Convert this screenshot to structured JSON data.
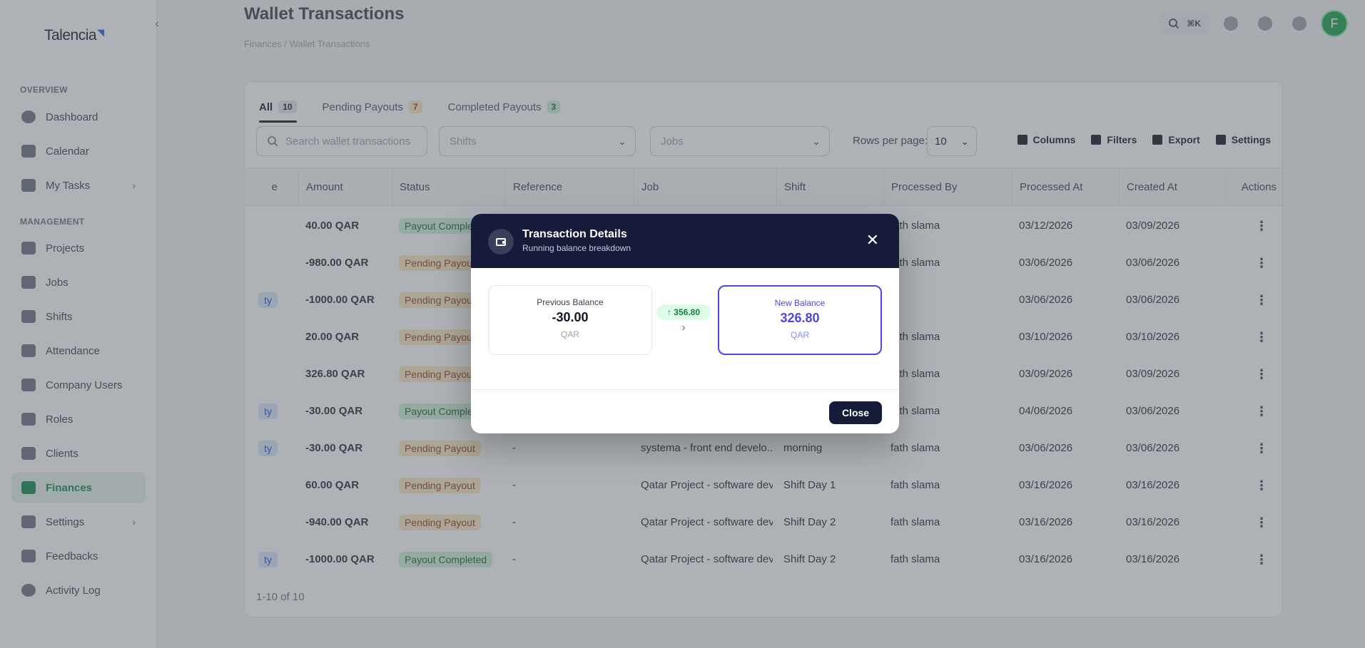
{
  "app": {
    "logo_text": "Talencia"
  },
  "sidebar": {
    "overview_label": "OVERVIEW",
    "management_label": "MANAGEMENT",
    "items": [
      {
        "label": "Dashboard",
        "icon": "dashboard-icon"
      },
      {
        "label": "Calendar",
        "icon": "calendar-icon"
      },
      {
        "label": "My Tasks",
        "icon": "tasks-icon"
      },
      {
        "label": "Projects",
        "icon": "projects-icon"
      },
      {
        "label": "Jobs",
        "icon": "jobs-icon"
      },
      {
        "label": "Shifts",
        "icon": "shifts-icon"
      },
      {
        "label": "Attendance",
        "icon": "attendance-icon"
      },
      {
        "label": "Company Users",
        "icon": "users-icon"
      },
      {
        "label": "Roles",
        "icon": "roles-icon"
      },
      {
        "label": "Clients",
        "icon": "clients-icon"
      },
      {
        "label": "Finances",
        "icon": "finances-icon"
      },
      {
        "label": "Settings",
        "icon": "settings-icon"
      },
      {
        "label": "Feedbacks",
        "icon": "feedback-icon"
      },
      {
        "label": "Activity Log",
        "icon": "activity-icon"
      }
    ]
  },
  "header": {
    "title": "Wallet Transactions",
    "breadcrumb": "Finances    /    Wallet Transactions",
    "search_shortcut": "⌘K",
    "avatar_initial": "F"
  },
  "tabs": [
    {
      "label": "All",
      "count": "10"
    },
    {
      "label": "Pending Payouts",
      "count": "7"
    },
    {
      "label": "Completed Payouts",
      "count": "3"
    }
  ],
  "toolbar": {
    "search_placeholder": "Search wallet transactions",
    "shifts_placeholder": "Shifts",
    "jobs_placeholder": "Jobs",
    "rows_label": "Rows per page:",
    "rows_value": "10",
    "columns_label": "Columns",
    "filters_label": "Filters",
    "export_label": "Export",
    "settings_label": "Settings"
  },
  "table": {
    "headers": {
      "type": "e",
      "amount": "Amount",
      "status": "Status",
      "reference": "Reference",
      "job": "Job",
      "shift": "Shift",
      "processed_by": "Processed By",
      "processed_at": "Processed At",
      "created_at": "Created At",
      "actions": "Actions"
    },
    "rows": [
      {
        "type": "",
        "amount": "40.00 QAR",
        "status": "Payout Completed",
        "status_kind": "completed",
        "reference": "",
        "job": "",
        "shift": "",
        "processed_by": "fath slama",
        "processed_at": "03/12/2026",
        "created_at": "03/09/2026"
      },
      {
        "type": "",
        "amount": "-980.00 QAR",
        "status": "Pending Payout",
        "status_kind": "pending",
        "reference": "",
        "job": "",
        "shift": "",
        "processed_by": "fath slama",
        "processed_at": "03/06/2026",
        "created_at": "03/06/2026"
      },
      {
        "type": "ty",
        "amount": "-1000.00 QAR",
        "status": "Pending Payout",
        "status_kind": "pending",
        "reference": "",
        "job": "",
        "shift": "",
        "processed_by": "",
        "processed_at": "03/06/2026",
        "created_at": "03/06/2026"
      },
      {
        "type": "",
        "amount": "20.00 QAR",
        "status": "Pending Payout",
        "status_kind": "pending",
        "reference": "",
        "job": "",
        "shift": "",
        "processed_by": "fath slama",
        "processed_at": "03/10/2026",
        "created_at": "03/10/2026"
      },
      {
        "type": "",
        "amount": "326.80 QAR",
        "status": "Pending Payout",
        "status_kind": "pending",
        "reference": "",
        "job": "",
        "shift": "",
        "processed_by": "fath slama",
        "processed_at": "03/09/2026",
        "created_at": "03/09/2026"
      },
      {
        "type": "ty",
        "amount": "-30.00 QAR",
        "status": "Payout Completed",
        "status_kind": "completed",
        "reference": "",
        "job": "",
        "shift": "",
        "processed_by": "fath slama",
        "processed_at": "04/06/2026",
        "created_at": "03/06/2026"
      },
      {
        "type": "ty",
        "amount": "-30.00 QAR",
        "status": "Pending Payout",
        "status_kind": "pending",
        "reference": "-",
        "job": "systema - front end develo...",
        "shift": "morning",
        "processed_by": "fath slama",
        "processed_at": "03/06/2026",
        "created_at": "03/06/2026"
      },
      {
        "type": "",
        "amount": "60.00 QAR",
        "status": "Pending Payout",
        "status_kind": "pending",
        "reference": "-",
        "job": "Qatar Project - software dev",
        "shift": "Shift Day 1",
        "processed_by": "fath slama",
        "processed_at": "03/16/2026",
        "created_at": "03/16/2026"
      },
      {
        "type": "",
        "amount": "-940.00 QAR",
        "status": "Pending Payout",
        "status_kind": "pending",
        "reference": "-",
        "job": "Qatar Project - software dev",
        "shift": "Shift Day 2",
        "processed_by": "fath slama",
        "processed_at": "03/16/2026",
        "created_at": "03/16/2026"
      },
      {
        "type": "ty",
        "amount": "-1000.00 QAR",
        "status": "Payout Completed",
        "status_kind": "completed",
        "reference": "-",
        "job": "Qatar Project - software dev",
        "shift": "Shift Day 2",
        "processed_by": "fath slama",
        "processed_at": "03/16/2026",
        "created_at": "03/16/2026"
      }
    ],
    "footer": "1-10 of 10"
  },
  "modal": {
    "title": "Transaction Details",
    "subtitle": "Running balance breakdown",
    "previous_label": "Previous Balance",
    "previous_value": "-30.00",
    "previous_unit": "QAR",
    "delta": "↑ 356.80",
    "new_label": "New Balance",
    "new_value": "326.80",
    "new_unit": "QAR",
    "close_label": "Close"
  },
  "colors": {
    "accent_green": "#0f8a4f",
    "modal_header": "#171b3a",
    "new_balance": "#4f46e5"
  }
}
